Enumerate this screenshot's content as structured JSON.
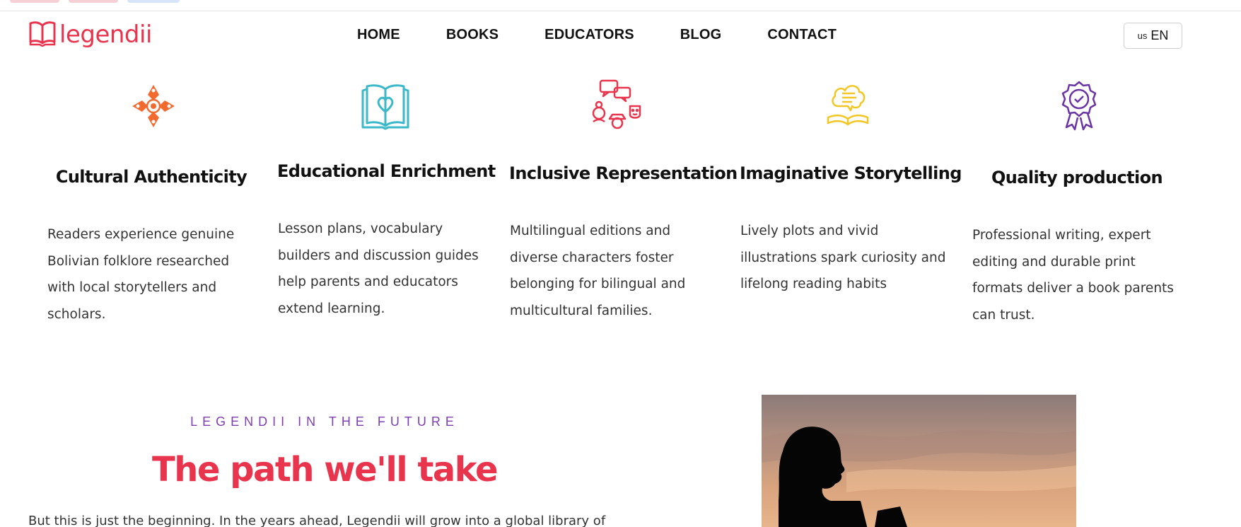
{
  "brand": {
    "logo_text": "legendii",
    "accent": "#e8344d"
  },
  "nav": {
    "items": [
      "HOME",
      "BOOKS",
      "EDUCATORS",
      "BLOG",
      "CONTACT"
    ]
  },
  "language": {
    "flag": "us",
    "code": "EN"
  },
  "features": [
    {
      "icon": "cultural-diamond-icon",
      "color": "#f26a2e",
      "title": "Cultural Authenticity",
      "body": "Readers experience genuine Bolivian folklore researched with local storytellers and scholars."
    },
    {
      "icon": "open-book-heart-icon",
      "color": "#3bb8c9",
      "title": "Educational Enrichment",
      "body": "Lesson plans, vocabulary builders and discussion guides help parents and educators extend learning."
    },
    {
      "icon": "diverse-people-chat-icon",
      "color": "#e8344d",
      "title": "Inclusive Representation",
      "body": "Multilingual editions and diverse characters foster belonging for bilingual and multicultural families."
    },
    {
      "icon": "story-book-thought-icon",
      "color": "#f3c623",
      "title": "Imaginative Storytelling",
      "body": "Lively plots and vivid illustrations spark curiosity and lifelong reading habits"
    },
    {
      "icon": "quality-badge-icon",
      "color": "#6b35a6",
      "title": "Quality production",
      "body": "Professional writing, expert editing and durable print formats deliver a book parents can trust."
    }
  ],
  "future": {
    "eyebrow": "LEGENDII IN THE FUTURE",
    "title": "The path we'll take",
    "body": "But this is just the beginning. In the years ahead, Legendii will grow into a global library of"
  }
}
